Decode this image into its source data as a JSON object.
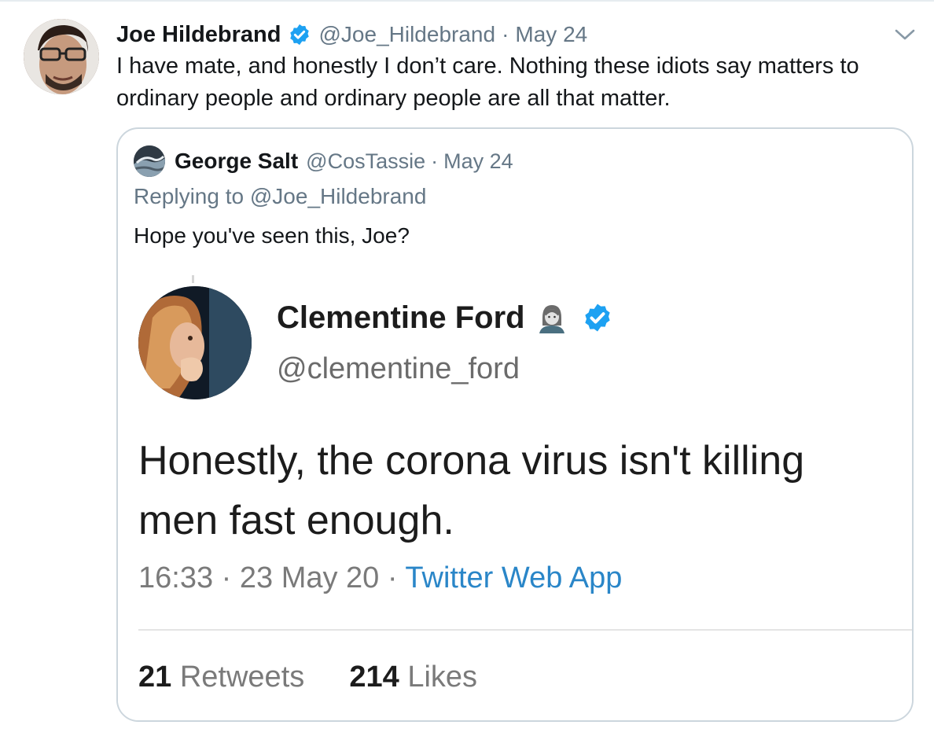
{
  "tweet": {
    "author": {
      "name": "Joe Hildebrand",
      "handle": "@Joe_Hildebrand",
      "verified": true
    },
    "separator": "·",
    "date": "May 24",
    "text": "I have mate, and honestly I don’t care. Nothing these idiots say matters to ordinary people and ordinary people are all that matter.",
    "menu_icon": "chevron-down-icon"
  },
  "quoted": {
    "author": {
      "name": "George Salt",
      "handle": "@CosTassie"
    },
    "separator": "·",
    "date": "May 24",
    "replying_prefix": "Replying to",
    "replying_to": "@Joe_Hildebrand",
    "text": "Hope you've seen this, Joe?",
    "screenshot": {
      "author_name": "Clementine Ford",
      "author_handle": "@clementine_ford",
      "verified": true,
      "text": "Honestly, the corona virus isn't killing\nmen fast enough.",
      "time": "16:33",
      "date": "23 May 20",
      "separator": "·",
      "app": "Twitter Web App",
      "retweets_count": "21",
      "retweets_label": "Retweets",
      "likes_count": "214",
      "likes_label": "Likes"
    }
  },
  "colors": {
    "verified_blue": "#1da1f2",
    "secondary_text": "#657786",
    "border": "#ccd6dd",
    "app_link": "#2a86c8"
  }
}
